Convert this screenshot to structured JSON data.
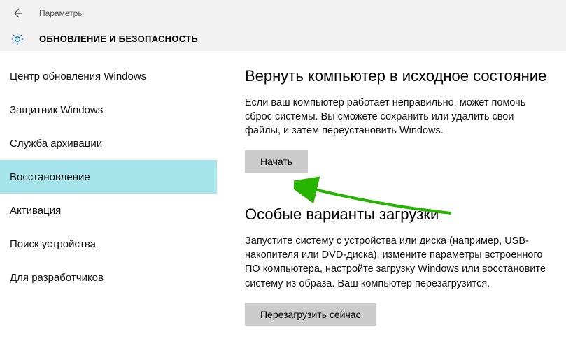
{
  "titlebar": {
    "label": "Параметры"
  },
  "header": {
    "title": "ОБНОВЛЕНИЕ И БЕЗОПАСНОСТЬ"
  },
  "sidebar": {
    "items": [
      {
        "label": "Центр обновления Windows",
        "selected": false
      },
      {
        "label": "Защитник Windows",
        "selected": false
      },
      {
        "label": "Служба архивации",
        "selected": false
      },
      {
        "label": "Восстановление",
        "selected": true
      },
      {
        "label": "Активация",
        "selected": false
      },
      {
        "label": "Поиск устройства",
        "selected": false
      },
      {
        "label": "Для разработчиков",
        "selected": false
      }
    ]
  },
  "main": {
    "reset": {
      "title": "Вернуть компьютер в исходное состояние",
      "text": "Если ваш компьютер работает неправильно, может помочь сброс системы. Вы сможете сохранить или удалить свои файлы, и затем переустановить Windows.",
      "button": "Начать"
    },
    "advanced": {
      "title": "Особые варианты загрузки",
      "text": "Запустите систему с устройства или диска (например, USB-накопителя или DVD-диска), измените параметры встроенного ПО компьютера, настройте загрузку Windows или восстановите систему из образа. Ваш компьютер перезагрузится.",
      "button": "Перезагрузить сейчас"
    }
  }
}
